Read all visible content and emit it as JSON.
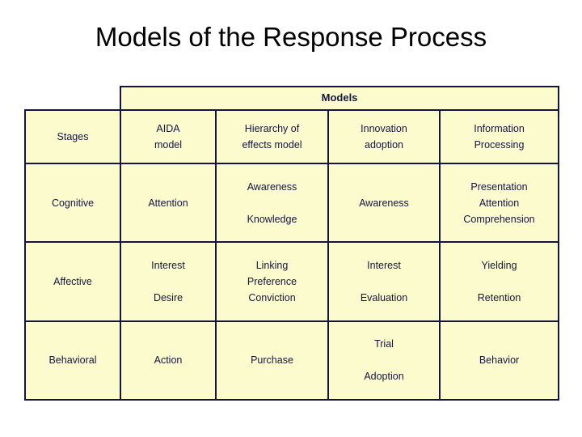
{
  "slide": {
    "title": "Models of the Response Process",
    "colors": {
      "border": "#15153f",
      "cell_fill": "#fbfbce",
      "text": "#15153f",
      "title_text": "#000000",
      "background": "#ffffff"
    }
  },
  "table": {
    "group_header": "Models",
    "stages_header": "Stages",
    "columns": [
      {
        "line1": "AIDA",
        "line2": "model"
      },
      {
        "line1": "Hierarchy of",
        "line2": "effects model"
      },
      {
        "line1": "Innovation",
        "line2": "adoption"
      },
      {
        "line1": "Information",
        "line2": "Processing"
      }
    ],
    "rows": [
      {
        "stage": "Cognitive",
        "cells": [
          {
            "lines": [
              "Attention"
            ],
            "gap_after_first": false
          },
          {
            "lines": [
              "Awareness",
              "",
              "Knowledge"
            ],
            "gap_after_first": true
          },
          {
            "lines": [
              "Awareness"
            ],
            "gap_after_first": false
          },
          {
            "lines": [
              "Presentation",
              "Attention",
              "Comprehension"
            ],
            "gap_after_first": false
          }
        ]
      },
      {
        "stage": "Affective",
        "cells": [
          {
            "lines": [
              "Interest",
              "",
              "Desire"
            ],
            "gap_after_first": true
          },
          {
            "lines": [
              "Linking",
              "Preference",
              "Conviction"
            ],
            "gap_after_first": false
          },
          {
            "lines": [
              "Interest",
              "",
              "Evaluation"
            ],
            "gap_after_first": true
          },
          {
            "lines": [
              "Yielding",
              "",
              "Retention"
            ],
            "gap_after_first": true
          }
        ]
      },
      {
        "stage": "Behavioral",
        "cells": [
          {
            "lines": [
              "Action"
            ],
            "gap_after_first": false
          },
          {
            "lines": [
              "Purchase"
            ],
            "gap_after_first": false
          },
          {
            "lines": [
              "Trial",
              "",
              "Adoption"
            ],
            "gap_after_first": true
          },
          {
            "lines": [
              "Behavior"
            ],
            "gap_after_first": false
          }
        ]
      }
    ]
  }
}
